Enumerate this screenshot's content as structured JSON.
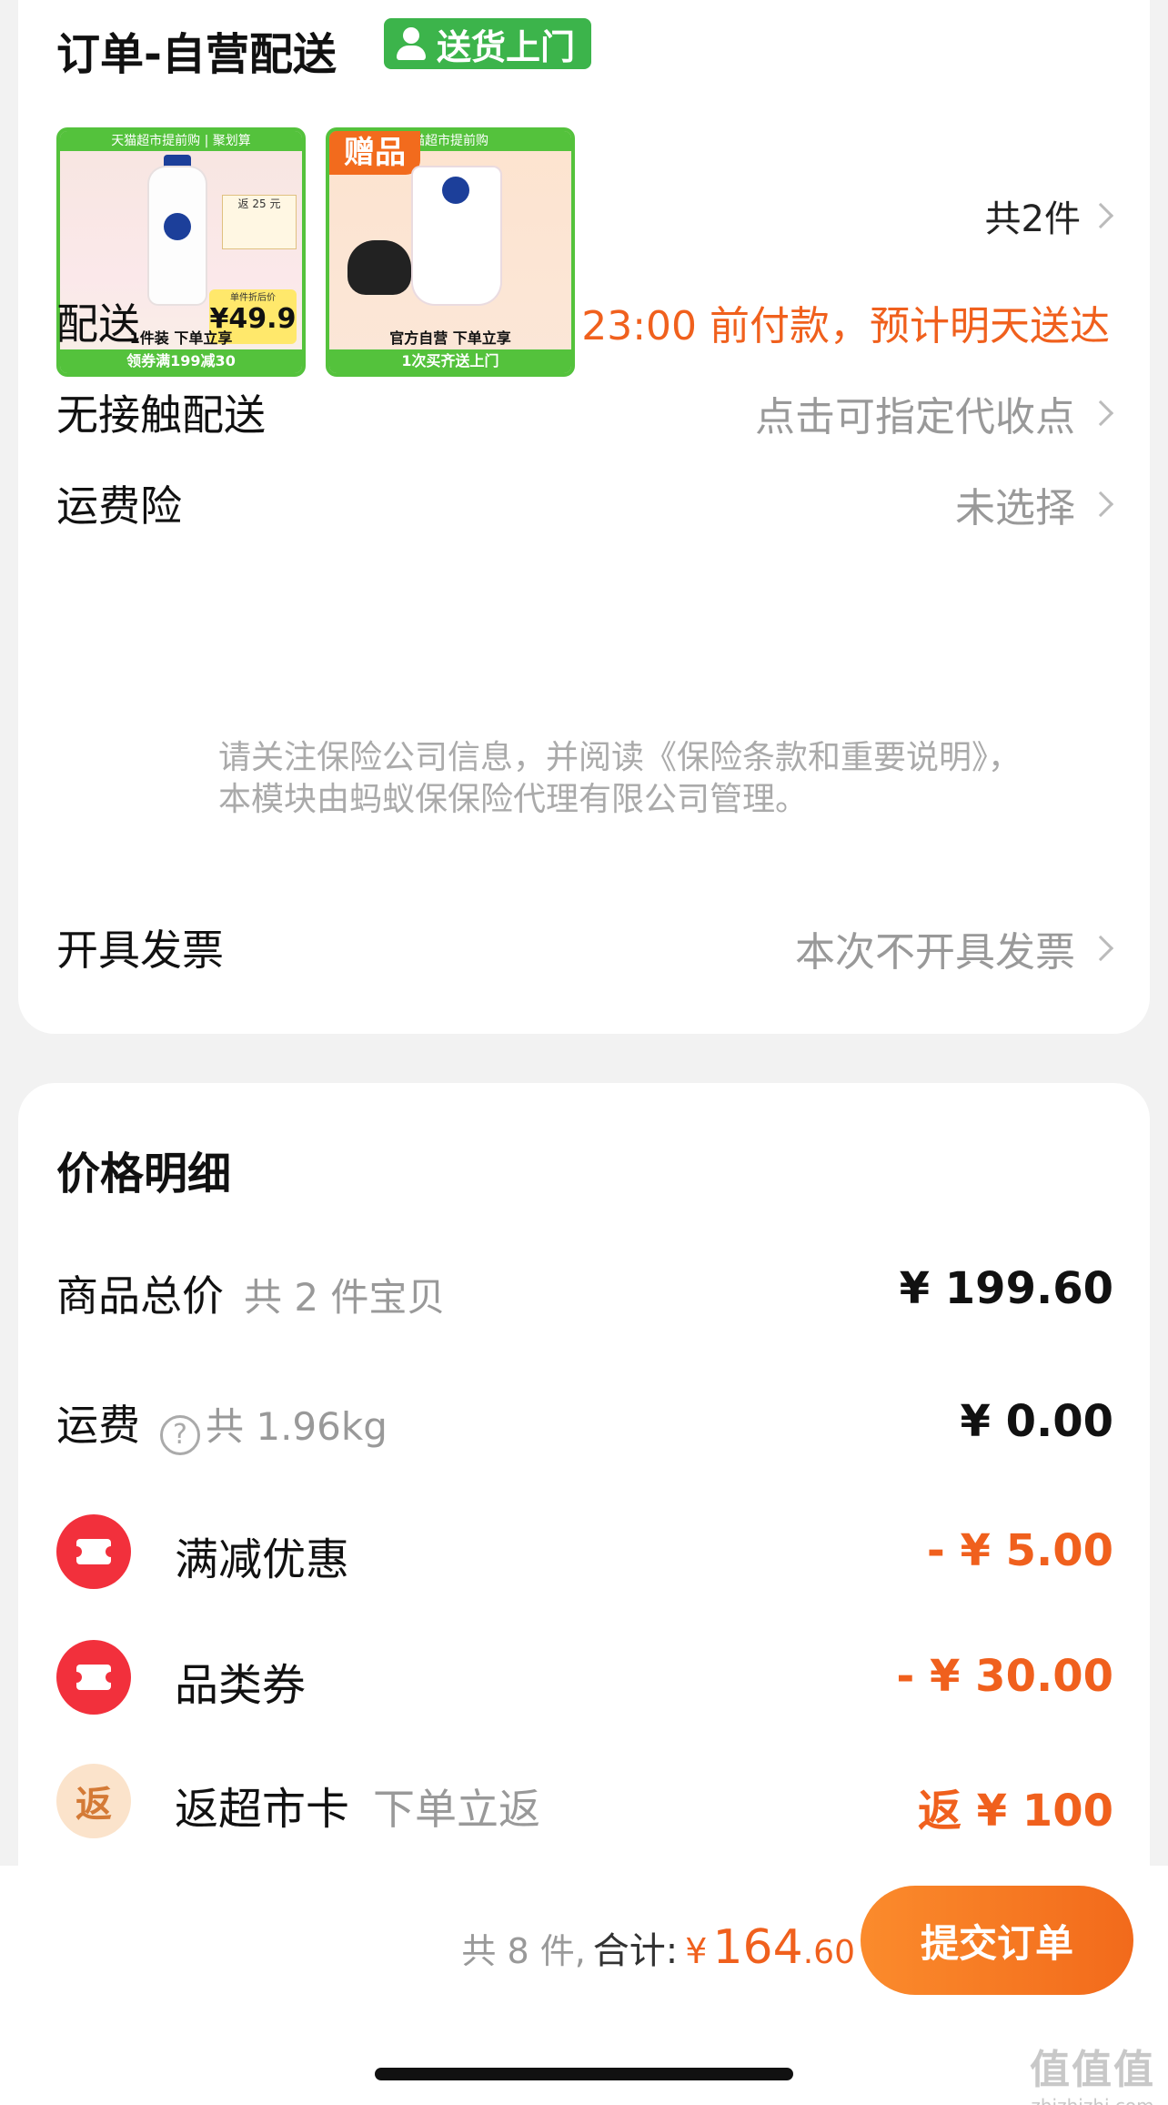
{
  "order": {
    "title": "订单-自营配送",
    "delivery_tag": "送货上门",
    "item_count": "共2件",
    "products": [
      {
        "strip": "天猫超市提前购 | 聚划算",
        "rebate": "返 25 元",
        "price_caption": "单件折后价",
        "price": "¥49.9",
        "promo": "1件装 下单立享",
        "bottom": "领券满199减30"
      },
      {
        "gift": "赠品",
        "strip": "猫超市提前购",
        "promo": "官方自营 下单立享",
        "bottom": "1次买齐送上门"
      }
    ],
    "delivery": {
      "label": "配送",
      "value": "23:00 前付款，预计明天送达"
    },
    "contactless": {
      "label": "无接触配送",
      "value": "点击可指定代收点"
    },
    "insurance": {
      "label": "运费险",
      "value": "未选择",
      "note": "请关注保险公司信息，并阅读《保险条款和重要说明》，本模块由蚂蚁保保险代理有限公司管理。"
    },
    "invoice": {
      "label": "开具发票",
      "value": "本次不开具发票"
    }
  },
  "price_detail": {
    "title": "价格明细",
    "goods_total": {
      "label": "商品总价",
      "sub": "共 2 件宝贝",
      "value": "¥ 199.60"
    },
    "shipping": {
      "label": "运费",
      "help": "?",
      "sub": "共 1.96kg",
      "value": "¥ 0.00"
    },
    "full_discount": {
      "label": "满减优惠",
      "value": "- ¥ 5.00"
    },
    "category_coupon": {
      "label": "品类券",
      "value": "- ¥ 30.00"
    },
    "rebate_card": {
      "icon_text": "返",
      "label": "返超市卡",
      "sub": "下单立返",
      "value": "返 ¥ 100"
    }
  },
  "footer": {
    "count": "共 8 件,",
    "total_label": "合计:",
    "currency": "¥",
    "total_int": "164",
    "total_dec": ".60",
    "submit": "提交订单"
  },
  "watermark": {
    "big": "值值值",
    "small": "zhizhizhi.com"
  },
  "colors": {
    "accent": "#f0601d",
    "green": "#3cb44b",
    "coupon_red": "#f2303c"
  }
}
